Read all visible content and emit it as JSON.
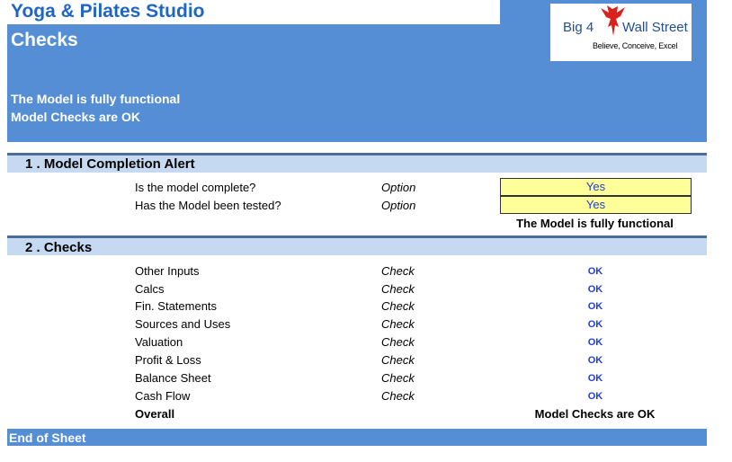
{
  "header": {
    "app_title": "Yoga & Pilates Studio",
    "page_title": "Checks",
    "status_line_1": "The Model is fully functional",
    "status_line_2": "Model Checks are OK"
  },
  "logo": {
    "text_left": "Big 4",
    "text_right": "Wall Street",
    "tagline": "Believe, Conceive, Excel",
    "icon": "eagle-icon"
  },
  "section1": {
    "title": "1 . Model Completion Alert",
    "rows": [
      {
        "label": "Is the model complete?",
        "type": "Option",
        "value": "Yes"
      },
      {
        "label": "Has the Model been tested?",
        "type": "Option",
        "value": "Yes"
      }
    ],
    "status": "The Model is fully functional"
  },
  "section2": {
    "title": "2 . Checks",
    "rows": [
      {
        "label": "Other Inputs",
        "type": "Check",
        "value": "OK"
      },
      {
        "label": "Calcs",
        "type": "Check",
        "value": "OK"
      },
      {
        "label": "Fin. Statements",
        "type": "Check",
        "value": "OK"
      },
      {
        "label": "Sources and Uses",
        "type": "Check",
        "value": "OK"
      },
      {
        "label": "Valuation",
        "type": "Check",
        "value": "OK"
      },
      {
        "label": "Profit & Loss",
        "type": "Check",
        "value": "OK"
      },
      {
        "label": "Balance Sheet",
        "type": "Check",
        "value": "OK"
      },
      {
        "label": "Cash Flow",
        "type": "Check",
        "value": "OK"
      }
    ],
    "overall_label": "Overall",
    "overall_status": "Model Checks are OK"
  },
  "footer": {
    "text": "End of Sheet"
  },
  "colors": {
    "header_blue": "#558ED5",
    "title_blue": "#1F66C4",
    "section_fill": "#C5D9F1",
    "input_yellow": "#FFFF99",
    "ok_blue": "#1F3FD0"
  }
}
